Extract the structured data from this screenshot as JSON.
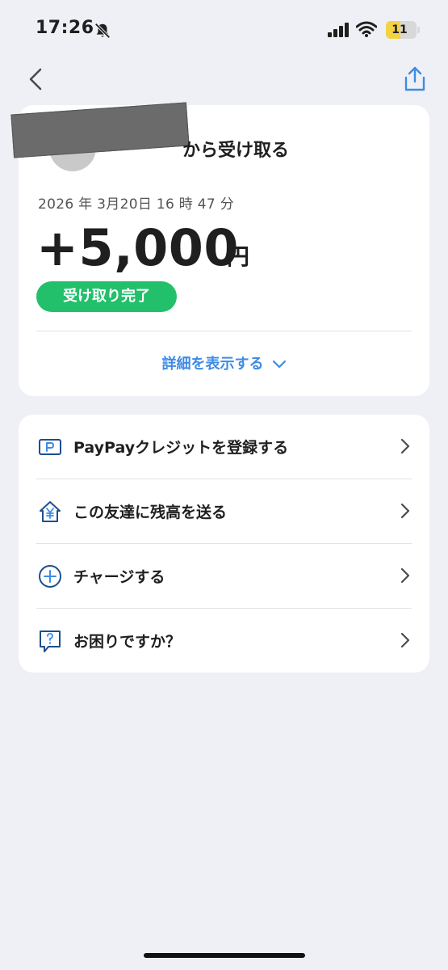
{
  "status_bar": {
    "time": "17:26",
    "battery_level": "11",
    "icons": [
      "bell-slash-icon",
      "cellular-signal-icon",
      "wifi-icon",
      "battery-icon"
    ]
  },
  "nav": {
    "back_icon": "chevron-left-icon",
    "share_icon": "share-icon"
  },
  "transaction": {
    "sender_suffix": "から受け取る",
    "datetime": "2026 年 3月20日 16 時 47 分",
    "amount": "+5,000",
    "currency": "円",
    "status": "受け取り完了",
    "details_label": "詳細を表示する"
  },
  "menu": {
    "items": [
      {
        "label": "PayPayクレジットを登録する",
        "icon": "credit-card-icon"
      },
      {
        "label": "この友達に残高を送る",
        "icon": "yen-house-icon"
      },
      {
        "label": "チャージする",
        "icon": "plus-circle-icon"
      },
      {
        "label": "お困りですか？",
        "icon": "help-bubble-icon"
      }
    ]
  },
  "colors": {
    "background": "#eff0f5",
    "card": "#ffffff",
    "accent_blue": "#3f8be5",
    "icon_blue": "#1d4f8c",
    "status_green": "#22c06a",
    "battery_yellow": "#f3d343"
  }
}
